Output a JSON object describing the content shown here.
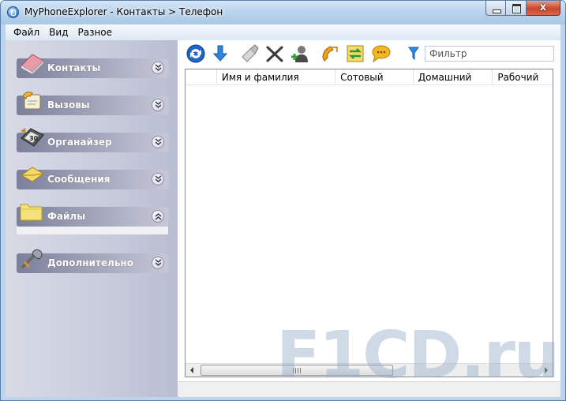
{
  "window": {
    "title": "MyPhoneExplorer -  Контакты > Телефон",
    "close_label": "x"
  },
  "menu": {
    "items": [
      "Файл",
      "Вид",
      "Разное"
    ]
  },
  "sidebar": {
    "groups": [
      {
        "label": "Контакты",
        "icon": "contacts-book-icon",
        "state": "collapsed"
      },
      {
        "label": "Вызовы",
        "icon": "phone-calls-icon",
        "state": "collapsed"
      },
      {
        "label": "Органайзер",
        "icon": "organizer-calendar-icon",
        "state": "collapsed"
      },
      {
        "label": "Сообщения",
        "icon": "envelope-icon",
        "state": "collapsed"
      },
      {
        "label": "Файлы",
        "icon": "folder-icon",
        "state": "expanded"
      },
      {
        "label": "Дополнительно",
        "icon": "tools-icon",
        "state": "collapsed"
      }
    ]
  },
  "toolbar": {
    "buttons": [
      "refresh-icon",
      "download-icon",
      "edit-icon",
      "delete-icon",
      "add-contact-icon",
      "call-icon",
      "sync-icon",
      "message-icon"
    ],
    "filter_placeholder": "Фильтр"
  },
  "table": {
    "columns": [
      "",
      "Имя и фамилия",
      "Сотовый",
      "Домашний",
      "Рабочий"
    ],
    "rows": []
  },
  "watermark": "F1CD.ru",
  "colors": {
    "sidebar_bg": "#c8cbdc",
    "group_header": "#9a9db3",
    "accent_blue": "#1d5ea8"
  }
}
